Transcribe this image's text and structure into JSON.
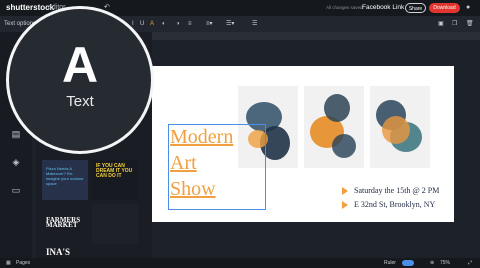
{
  "topbar": {
    "logo": "shutterstock",
    "logo2": "editor",
    "saved": "All changes saved",
    "doc_name": "Facebook Link",
    "share": "Share",
    "download": "Download"
  },
  "toolbar": {
    "text_options": "Text options"
  },
  "magnifier": {
    "letter": "A",
    "label": "Text"
  },
  "canvas": {
    "heading_lines": [
      "Modern",
      "Art",
      "Show"
    ],
    "details": [
      "Saturday the 15th @ 2 PM",
      "E 32nd St, Brooklyn, NY"
    ]
  },
  "panel": {
    "templates": [
      "Pizza Needs A Makeover? Re-imagine your outdoor space",
      "IF YOU CAN DREAM IT YOU CAN DO IT",
      "FARMERS MARKET",
      "INA'S"
    ]
  },
  "bottombar": {
    "pages": "Pages",
    "ruler": "Ruler",
    "zoom": "75%"
  },
  "colors": {
    "accent": "#f0a040",
    "download": "#e3352f",
    "selection": "#4a8fe7"
  }
}
